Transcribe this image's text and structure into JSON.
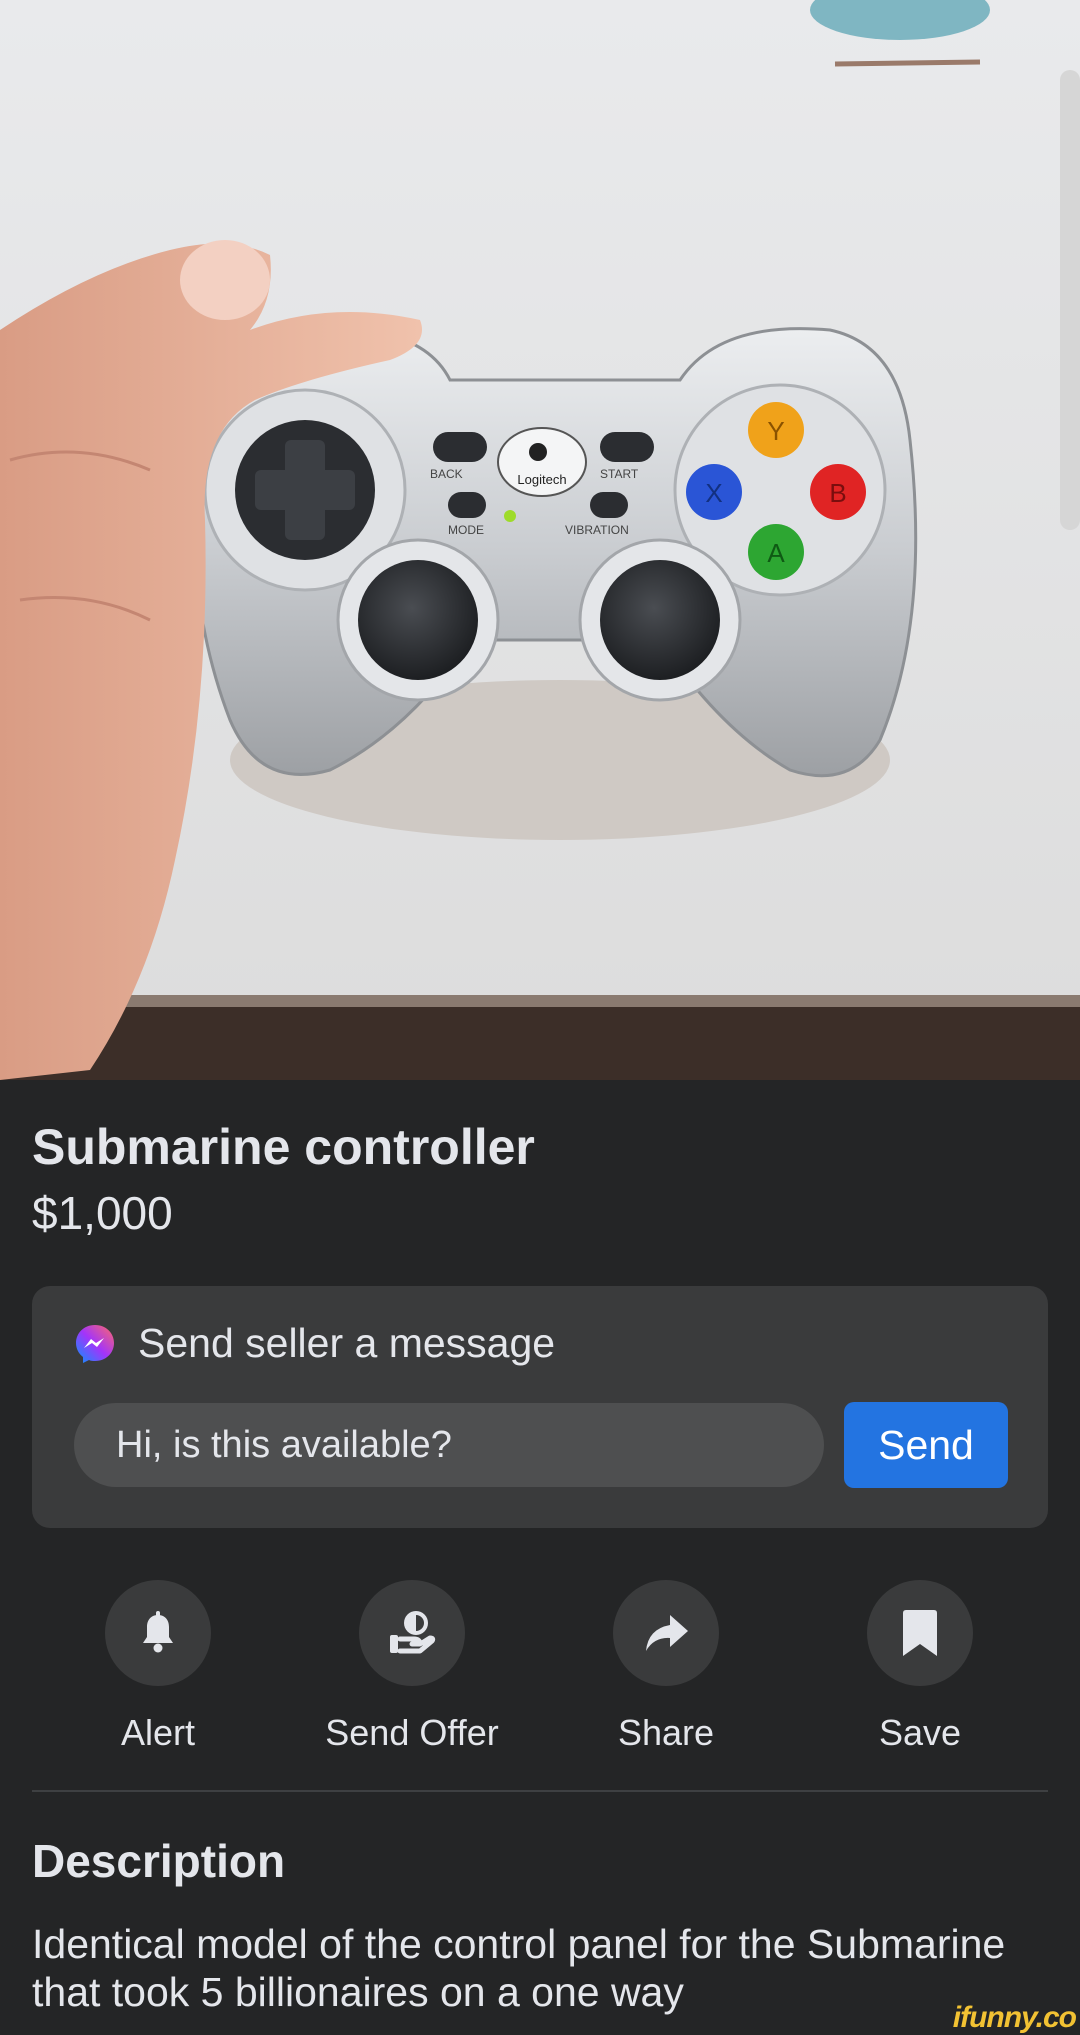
{
  "listing": {
    "title": "Submarine controller",
    "price": "$1,000"
  },
  "message": {
    "header": "Send seller a message",
    "input_value": "Hi, is this available?",
    "send_label": "Send"
  },
  "actions": [
    {
      "label": "Alert",
      "icon": "bell-icon"
    },
    {
      "label": "Send Offer",
      "icon": "offer-icon"
    },
    {
      "label": "Share",
      "icon": "share-arrow-icon"
    },
    {
      "label": "Save",
      "icon": "bookmark-icon"
    }
  ],
  "description": {
    "heading": "Description",
    "text": "Identical model of the control panel for the Submarine that took 5 billionaires on a one way"
  },
  "photo": {
    "brand": "Logitech",
    "labels": {
      "back": "BACK",
      "start": "START",
      "mode": "MODE",
      "vibration": "VIBRATION"
    },
    "buttons": {
      "y": "Y",
      "x": "X",
      "b": "B",
      "a": "A"
    }
  },
  "watermark": "ifunny.co",
  "colors": {
    "background": "#242526",
    "card": "#3a3b3c",
    "accent": "#2374e1",
    "text": "#e4e6eb"
  }
}
